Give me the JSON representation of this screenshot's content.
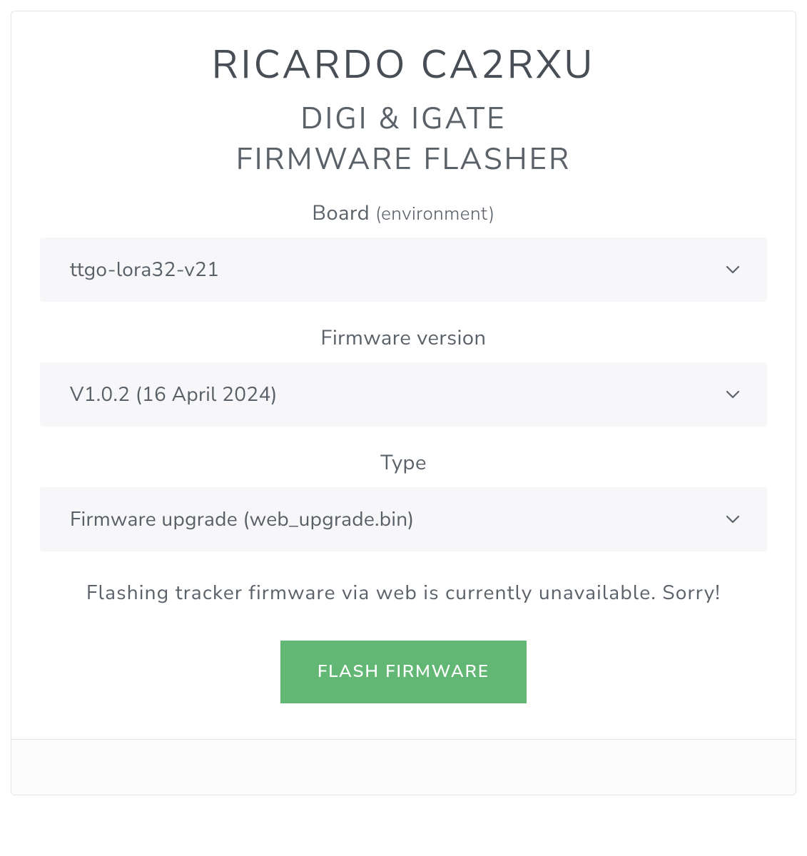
{
  "header": {
    "title": "RICARDO CA2RXU",
    "subtitle_line1": "DIGI & IGATE",
    "subtitle_line2": "FIRMWARE FLASHER"
  },
  "board": {
    "label_main": "Board",
    "label_sub": "(environment)",
    "selected": "ttgo-lora32-v21"
  },
  "firmware": {
    "label": "Firmware version",
    "selected": "V1.0.2 (16 April 2024)"
  },
  "type": {
    "label": "Type",
    "selected": "Firmware upgrade (web_upgrade.bin)"
  },
  "message": "Flashing tracker firmware via web is currently unavailable. Sorry!",
  "button": {
    "flash_label": "FLASH FIRMWARE"
  }
}
